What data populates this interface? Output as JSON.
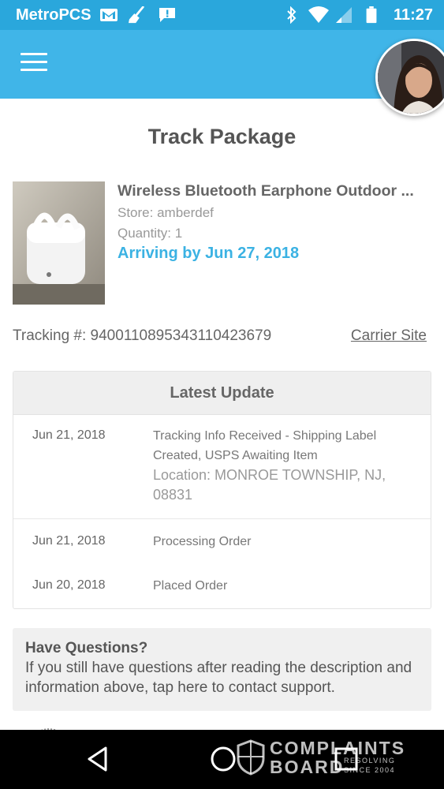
{
  "status_bar": {
    "carrier": "MetroPCS",
    "time": "11:27"
  },
  "header": {
    "menu_icon": "hamburger-menu-icon",
    "avatar_icon": "user-avatar"
  },
  "page": {
    "title": "Track Package"
  },
  "product": {
    "name": "Wireless Bluetooth Earphone Outdoor ...",
    "store": "Store: amberdef",
    "quantity": "Quantity: 1",
    "arrival": "Arriving by Jun 27, 2018"
  },
  "tracking": {
    "label": "Tracking #: 9400110895343110423679",
    "carrier_link": "Carrier Site"
  },
  "latest_update": {
    "title": "Latest Update",
    "rows": [
      {
        "date": "Jun 21, 2018",
        "text": "Tracking Info Received - Shipping Label Created, USPS Awaiting Item",
        "location": "Location: MONROE TOWNSHIP, NJ, 08831"
      },
      {
        "date": "Jun 21, 2018",
        "text": "Processing Order"
      },
      {
        "date": "Jun 20, 2018",
        "text": "Placed Order"
      }
    ]
  },
  "questions": {
    "title": "Have Questions?",
    "body": "If you still have questions after reading the description and information above, tap here to contact support."
  },
  "watermark": {
    "line1": "COMPLAINTS",
    "line2": "BOARD",
    "tagline1": "RESOLVING",
    "tagline2": "SINCE 2004"
  },
  "colors": {
    "status_bar": "#2aa7dc",
    "app_bar": "#40b5e8",
    "accent": "#3bb2e3"
  }
}
